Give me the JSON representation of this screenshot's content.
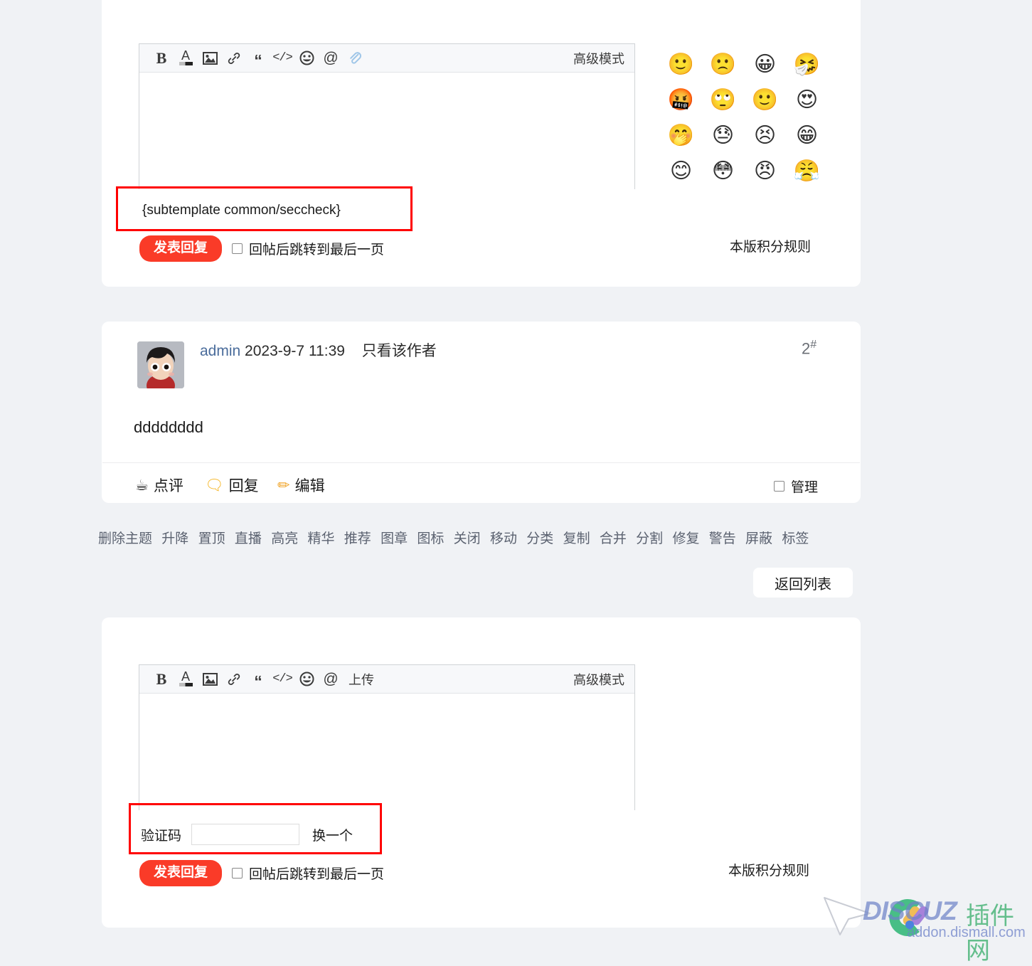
{
  "page": {
    "background_color": "#f0f2f5",
    "card_color": "#ffffff",
    "accent_color": "#fa3b28",
    "annotation_color": "#ff0000"
  },
  "reply_box_top": {
    "toolbar": {
      "bold": "B",
      "font_color": "A",
      "image": "image-icon",
      "link": "link-icon",
      "quote": "“",
      "code": "</>",
      "smiley": "smiley-icon",
      "mention": "@",
      "attachment": "paperclip-icon",
      "advanced_mode": "高级模式"
    },
    "textarea_value": "",
    "seccheck_placeholder_text": "{subtemplate common/seccheck}",
    "submit_label": "发表回复",
    "jump_checkbox_label": "回帖后跳转到最后一页",
    "jump_checkbox_checked": false,
    "points_rule_link": "本版积分规则"
  },
  "emoji_panel": {
    "rows": [
      [
        "🙂",
        "🙁",
        "😀",
        "🤧"
      ],
      [
        "🤬",
        "🙄",
        "🙂",
        "😍"
      ],
      [
        "🤭",
        "😓",
        "😣",
        "😁"
      ],
      [
        "😊",
        "😳",
        "😠",
        "😤"
      ]
    ]
  },
  "post": {
    "avatar_alt": "admin-avatar",
    "author": "admin",
    "datetime": "2023-9-7 11:39",
    "only_author_link": "只看该作者",
    "floor_number": "2",
    "floor_suffix": "#",
    "content": "dddddddd",
    "actions": [
      {
        "icon": "coffee-icon",
        "glyph": "☕",
        "label": "点评"
      },
      {
        "icon": "comment-icon",
        "glyph": "🗨",
        "label": "回复"
      },
      {
        "icon": "pencil-icon",
        "glyph": "✏",
        "label": "编辑"
      }
    ],
    "manage_checkbox_label": "管理",
    "manage_checkbox_checked": false
  },
  "moderation": {
    "links": [
      "删除主题",
      "升降",
      "置顶",
      "直播",
      "高亮",
      "精华",
      "推荐",
      "图章",
      "图标",
      "关闭",
      "移动",
      "分类",
      "复制",
      "合并",
      "分割",
      "修复",
      "警告",
      "屏蔽",
      "标签"
    ]
  },
  "return_button": {
    "label": "返回列表"
  },
  "reply_box_bottom": {
    "toolbar": {
      "bold": "B",
      "font_color": "A",
      "image": "image-icon",
      "link": "link-icon",
      "quote": "“",
      "code": "</>",
      "smiley": "smiley-icon",
      "mention": "@",
      "upload_label": "上传",
      "advanced_mode": "高级模式"
    },
    "textarea_value": "",
    "captcha": {
      "label": "验证码",
      "value": "",
      "refresh_label": "换一个"
    },
    "submit_label": "发表回复",
    "jump_checkbox_label": "回帖后跳转到最后一页",
    "jump_checkbox_checked": false,
    "points_rule_link": "本版积分规则"
  },
  "watermark": {
    "brand": "DISCUZ",
    "brand_cn": "插件网",
    "domain": "addon.dismall.com"
  }
}
